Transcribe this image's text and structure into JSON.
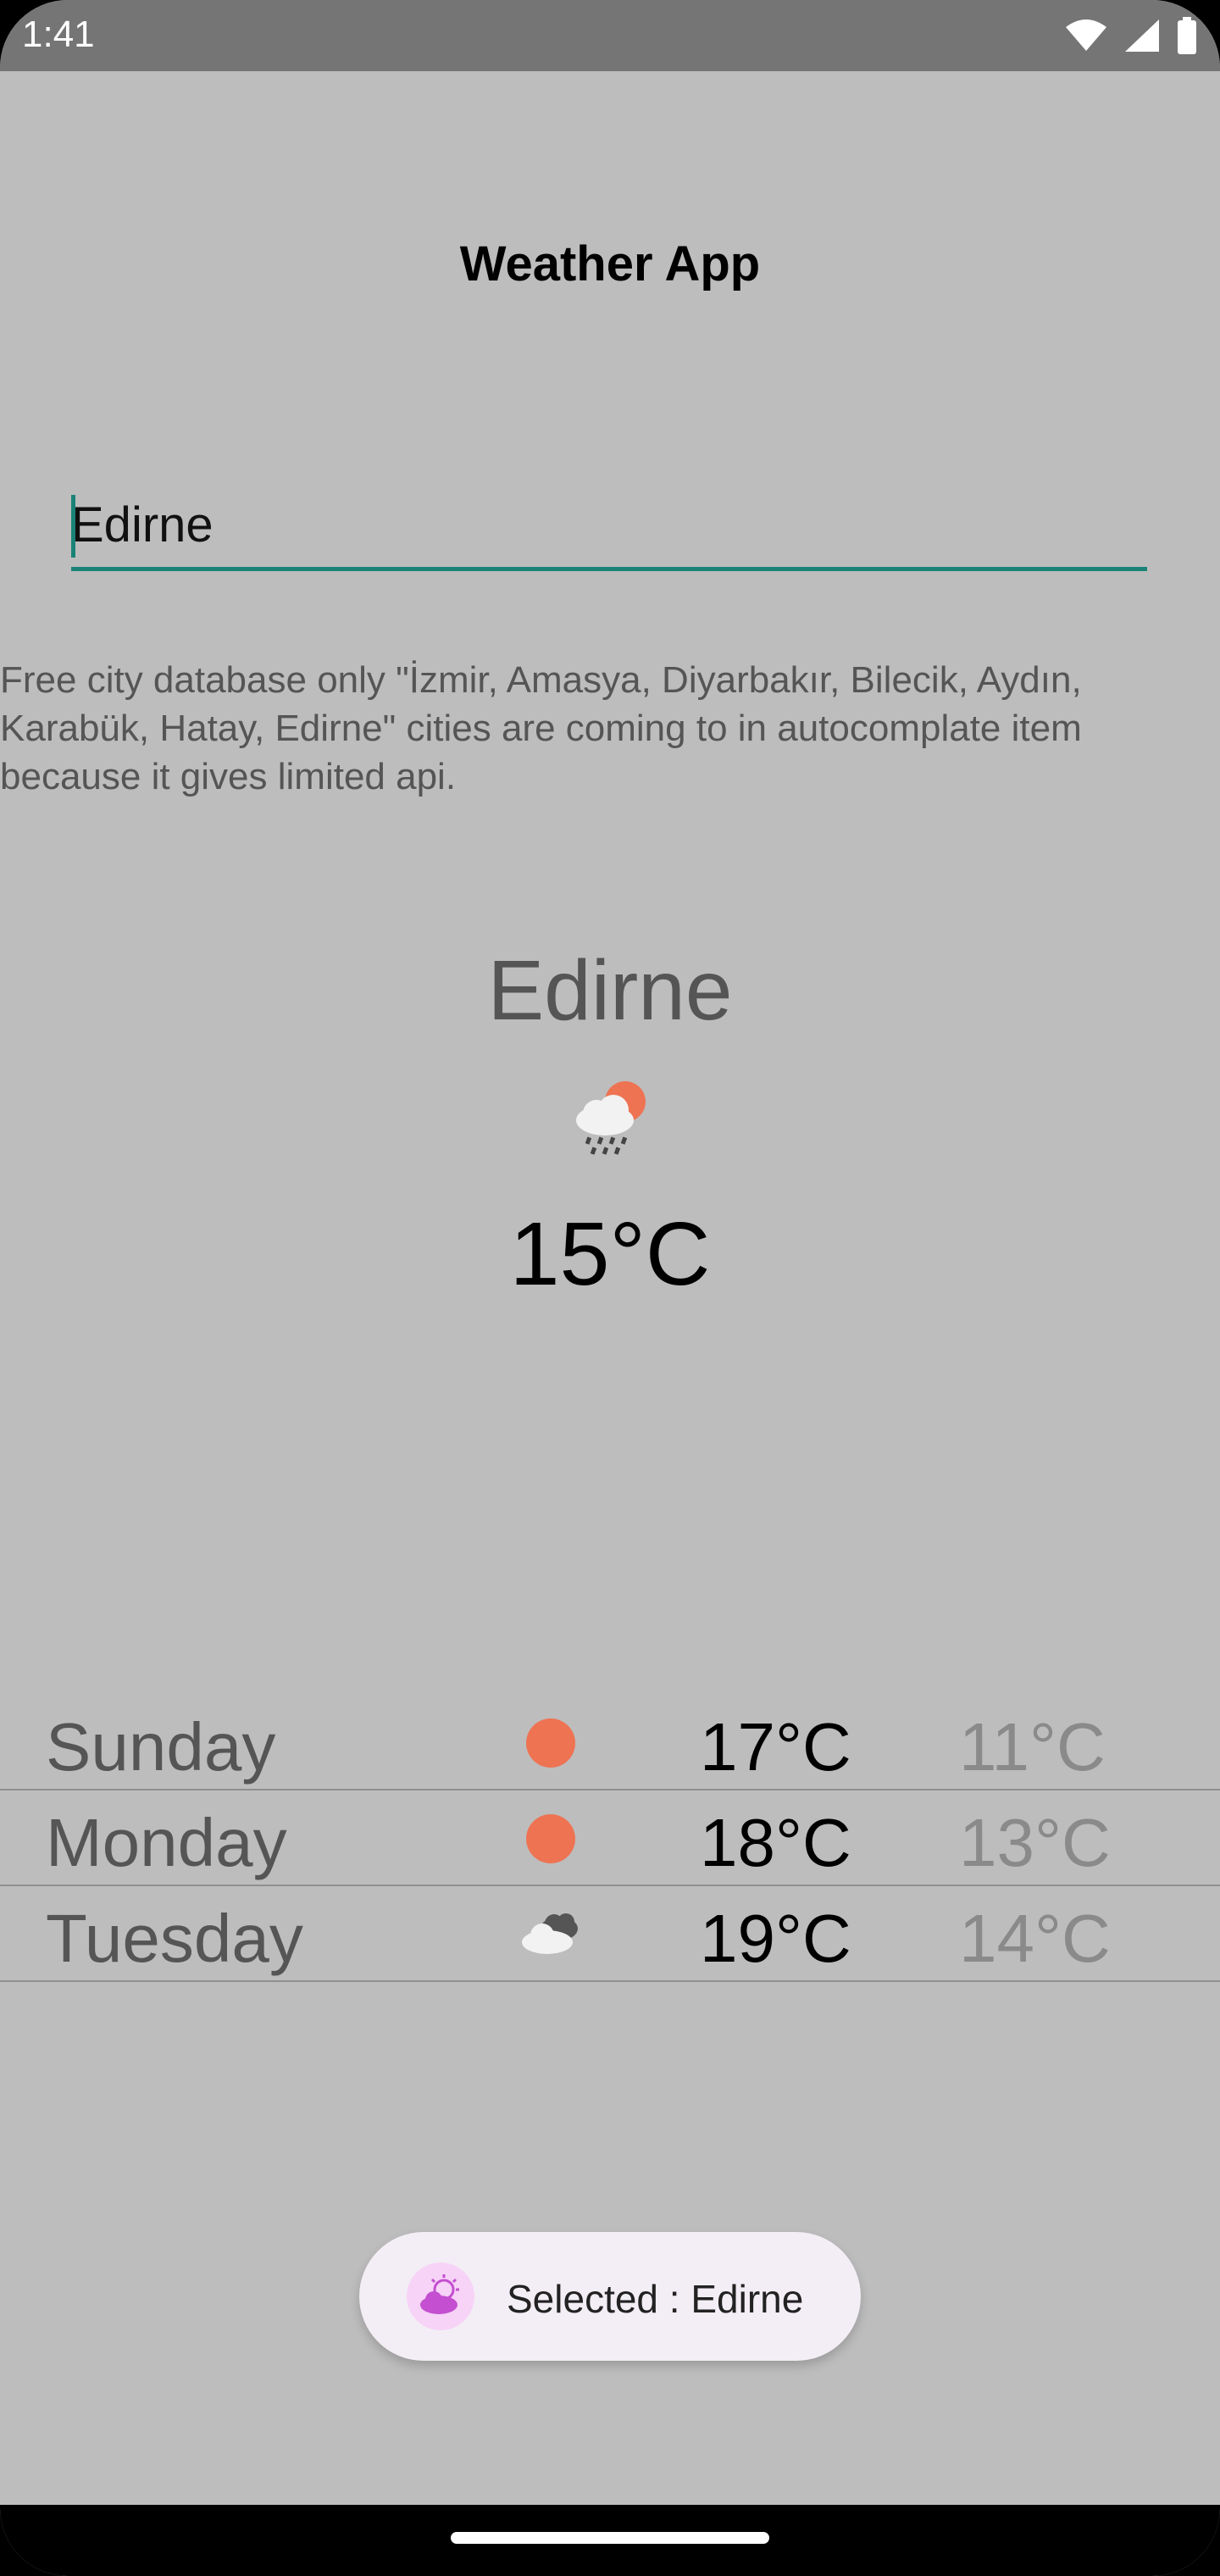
{
  "status_bar": {
    "time": "1:41"
  },
  "app": {
    "title": "Weather App"
  },
  "search": {
    "value": "Edirne"
  },
  "info_text": "Free city database only \"İzmir, Amasya, Diyarbakır, Bilecik, Aydın, Karabük, Hatay, Edirne\" cities are coming to in autocomplate item because it gives limited api.",
  "current": {
    "city": "Edirne",
    "icon": "rain-cloud-sun-icon",
    "temp": "15°C"
  },
  "forecast": [
    {
      "day": "Sunday",
      "icon": "sun-icon",
      "high": "17°C",
      "low": "11°C"
    },
    {
      "day": "Monday",
      "icon": "sun-icon",
      "high": "18°C",
      "low": "13°C"
    },
    {
      "day": "Tuesday",
      "icon": "clouds-icon",
      "high": "19°C",
      "low": "14°C"
    }
  ],
  "toast": {
    "text": "Selected : Edirne",
    "icon": "app-weather-icon"
  },
  "colors": {
    "accent": "#1a8377",
    "sun": "#ee7353",
    "background": "#bdbdbd"
  }
}
